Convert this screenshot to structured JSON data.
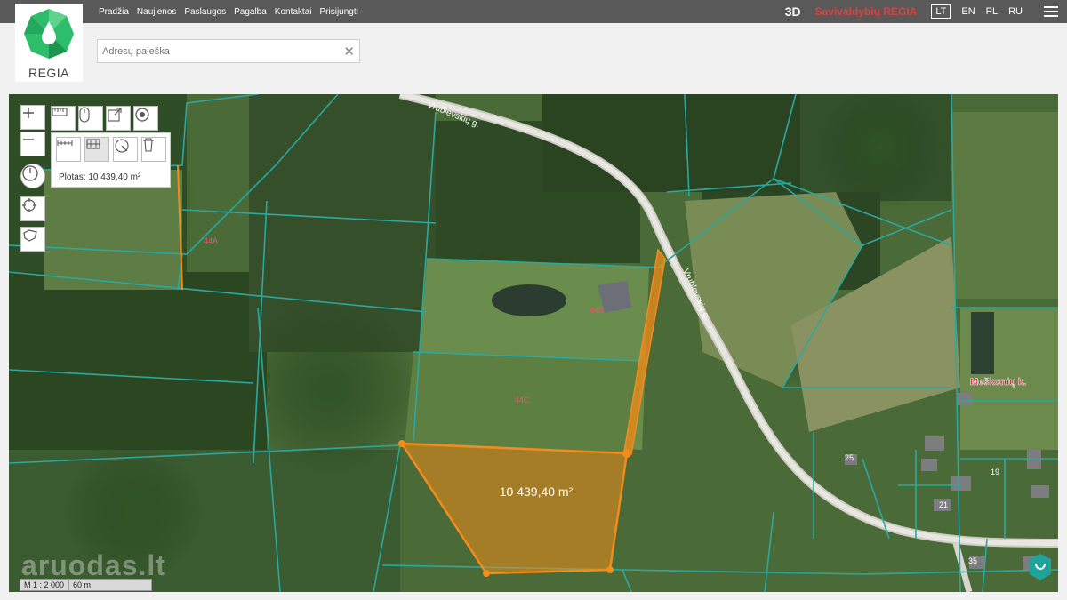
{
  "nav": {
    "items": [
      "Pradžia",
      "Naujienos",
      "Paslaugos",
      "Pagalba",
      "Kontaktai",
      "Prisijungti"
    ],
    "mode_3d": "3D",
    "brand": "Savivaldybių REGIA",
    "languages": [
      "LT",
      "EN",
      "PL",
      "RU"
    ],
    "active_language": "LT"
  },
  "logo": {
    "text": "REGIA"
  },
  "search": {
    "placeholder": "Adresų paieška",
    "value": ""
  },
  "map": {
    "measure_result": "Plotas: 10 439,40 m²",
    "polygon_area_label": "10 439,40 m²",
    "road_labels": [
      "Vrublevskių g.",
      "Vrublevskių g."
    ],
    "parcel_labels": [
      "44A",
      "44B",
      "44C"
    ],
    "village_label": "Meškonių k.",
    "house_numbers": [
      "25",
      "19",
      "21",
      "35"
    ],
    "scale": {
      "ratio": "M 1 : 2 000",
      "distance": "60 m"
    },
    "watermark": "aruodas.lt",
    "colors": {
      "measure": "#f28c1b",
      "parcel_lines": "#2ba8a0",
      "road": "#e8e6e0",
      "label": "#b0203a"
    }
  }
}
